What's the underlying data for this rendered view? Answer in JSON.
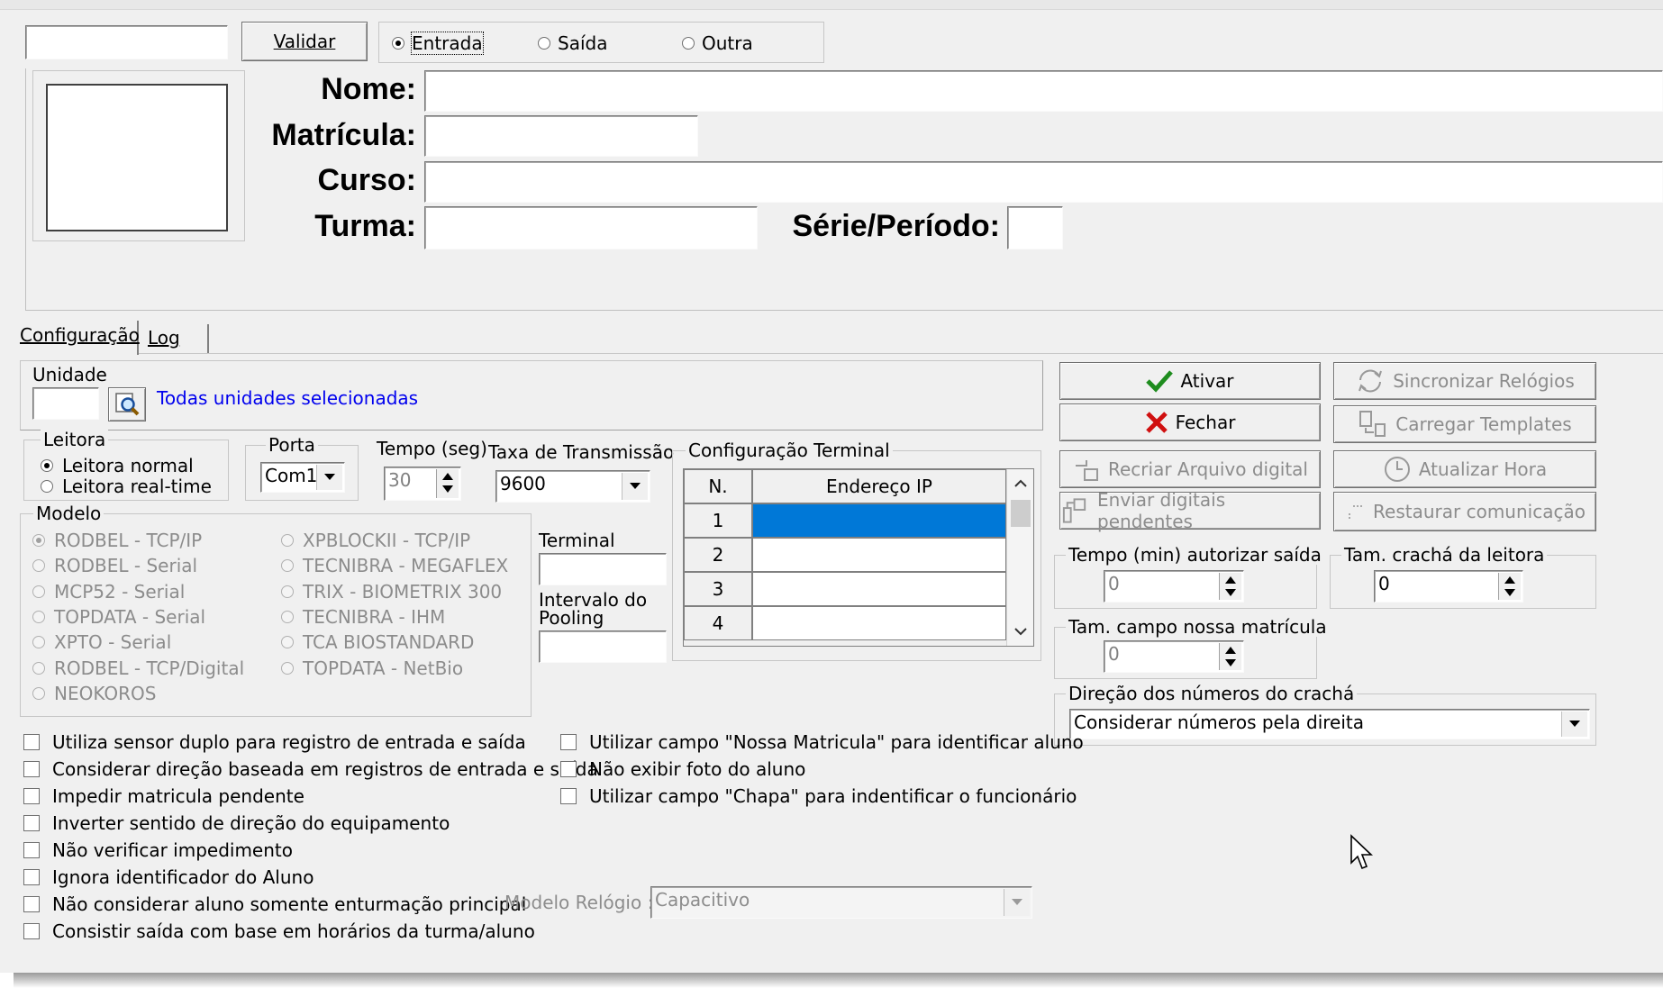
{
  "entry": {
    "code_value": "",
    "validate_label": "Validar",
    "direction_options": [
      "Entrada",
      "Saída",
      "Outra"
    ],
    "selected_direction": "Entrada"
  },
  "student": {
    "name_label": "Nome:",
    "registration_label": "Matrícula:",
    "course_label": "Curso:",
    "class_label": "Turma:",
    "period_label": "Série/Período:"
  },
  "tabs": [
    "Configuração",
    "Log"
  ],
  "unit": {
    "label": "Unidade",
    "value": "",
    "status": "Todas unidades selecionadas"
  },
  "reader": {
    "label": "Leitora",
    "options": [
      "Leitora normal",
      "Leitora real-time"
    ],
    "selected": "Leitora normal"
  },
  "port": {
    "label": "Porta",
    "value": "Com1"
  },
  "time": {
    "label": "Tempo (seg)",
    "value": "30"
  },
  "baud": {
    "label": "Taxa de Transmissão",
    "value": "9600"
  },
  "terminal": {
    "label": "Terminal",
    "interval_label": "Intervalo do Pooling"
  },
  "model": {
    "label": "Modelo",
    "options_left": [
      "RODBEL - TCP/IP",
      "RODBEL - Serial",
      "MCP52 - Serial",
      "TOPDATA - Serial",
      "XPTO - Serial",
      "RODBEL - TCP/Digital",
      "NEOKOROS"
    ],
    "options_right": [
      "XPBLOCKII - TCP/IP",
      "TECNIBRA - MEGAFLEX",
      "TRIX - BIOMETRIX 300",
      "TECNIBRA - IHM",
      "TCA BIOSTANDARD",
      "TOPDATA - NetBio"
    ],
    "selected": "RODBEL - TCP/IP"
  },
  "terminal_config": {
    "label": "Configuração Terminal",
    "col_n": "N.",
    "col_ip": "Endereço IP",
    "rows": [
      "1",
      "2",
      "3",
      "4"
    ]
  },
  "actions": {
    "activate": "Ativar",
    "close": "Fechar",
    "recreate": "Recriar Arquivo digital",
    "send_pending": "Enviar digitais pendentes",
    "sync_clocks": "Sincronizar Relógios",
    "load_templates": "Carregar Templates",
    "update_time": "Atualizar Hora",
    "restore_comm": "Restaurar comunicação"
  },
  "exit_time": {
    "label": "Tempo (min) autorizar saída",
    "value": "0"
  },
  "badge_size": {
    "label": "Tam. crachá da leitora",
    "value": "0"
  },
  "reg_field_size": {
    "label": "Tam. campo nossa matrícula",
    "value": "0"
  },
  "badge_direction": {
    "label": "Direção dos números do crachá",
    "value": "Considerar números pela direita"
  },
  "options_left": [
    "Utiliza sensor duplo para registro de entrada e saída",
    "Considerar direção baseada em registros de entrada e saída",
    "Impedir matricula pendente",
    "Inverter sentido de direção do equipamento",
    "Não verificar impedimento",
    "Ignora identificador do Aluno",
    "Não considerar aluno somente enturmação principal",
    "Consistir saída com base em horários da turma/aluno"
  ],
  "options_right": [
    "Utilizar campo \"Nossa Matricula\" para identificar aluno",
    "Não exibir foto do aluno",
    "Utilizar campo \"Chapa\" para indentificar o funcionário"
  ],
  "clock_model": {
    "label": "Modelo Relógio :",
    "value": "Capacitivo"
  }
}
